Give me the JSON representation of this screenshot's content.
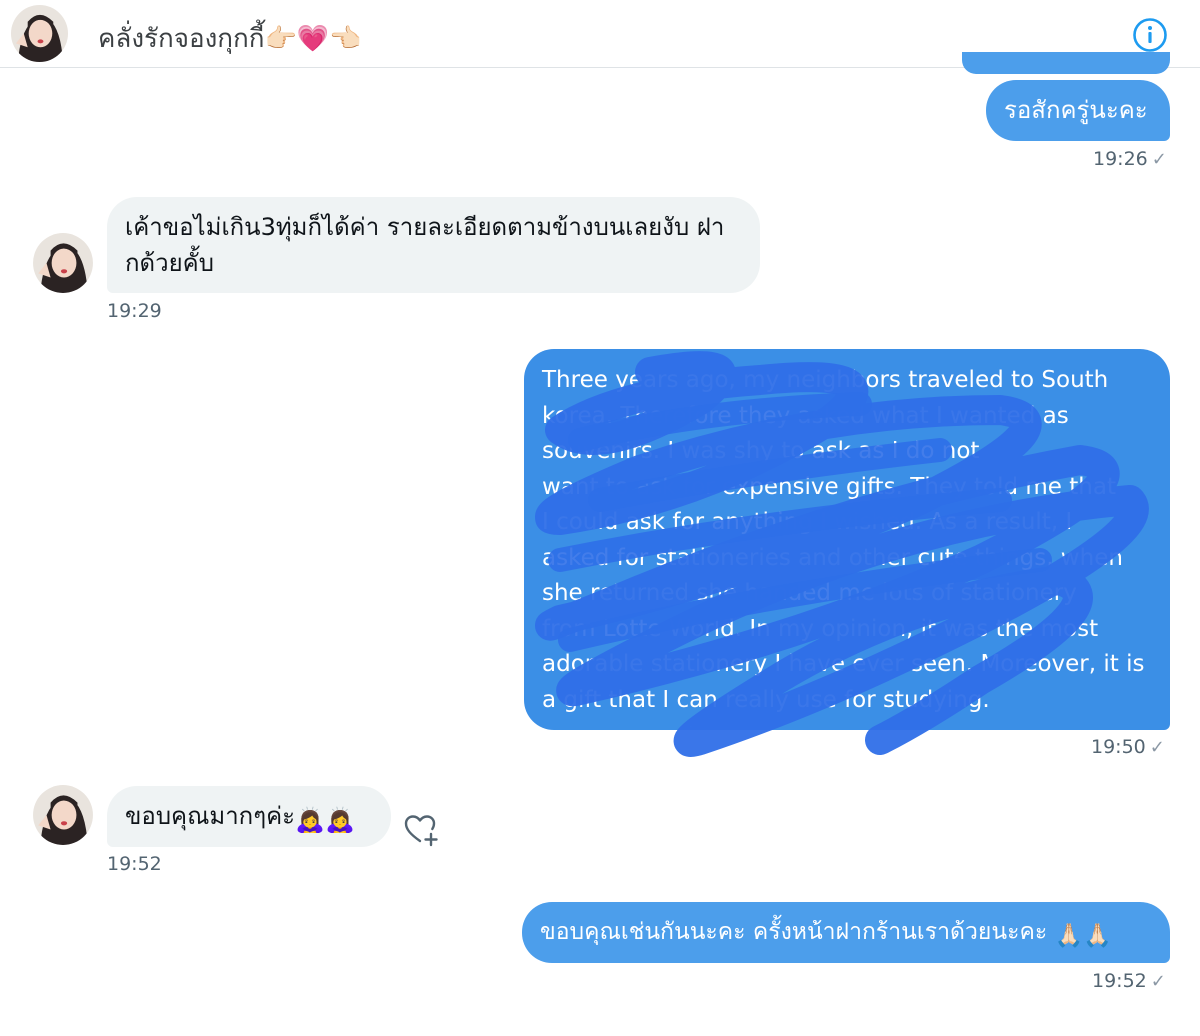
{
  "conversation": {
    "title": "คลั่งรักจองกุกกี้",
    "title_emoji": [
      "👉🏻",
      "💗",
      "👈🏻"
    ],
    "header_icons": [
      "avatar",
      "info-icon"
    ]
  },
  "messages": [
    {
      "id": "m1",
      "side": "out",
      "text": "รอสักครู่นะคะ",
      "time": "19:26",
      "status": "sent-check-icon"
    },
    {
      "id": "m2",
      "side": "in",
      "line1": "เค้าขอไม่เกิน3ทุ่มก็ได้ค่า รายละเอียดตามข้างบนเลยงับ ฝา",
      "line2": "กด้วยคั้บ",
      "time": "19:29"
    },
    {
      "id": "m3",
      "side": "out",
      "redacted": true,
      "lines": [
        "Three years ago, my neighbors traveled to South",
        "korea. Therefore they asked what I wanted as",
        "souvenirs. I was shy to ask as I do not",
        "want to ask for expensive gifts. They told me that",
        "I could ask for anything I wished. As a result, I",
        "asked for stationeries and other cute things, when",
        "she returned she handed me lots of stationery",
        "from Lotte World. In my opinion, it was the most",
        "adorable stationery I have ever seen. Moreover, it is",
        "a gift that I can really use for studying."
      ],
      "time": "19:50",
      "status": "sent-check-icon"
    },
    {
      "id": "m4",
      "side": "in",
      "text": "ขอบคุณมากๆค่ะ",
      "emoji": [
        "🙇‍♀️",
        "🙇‍♀️"
      ],
      "time": "19:52",
      "reaction_button": "add-reaction-heart-icon"
    },
    {
      "id": "m5",
      "side": "out",
      "text": "ขอบคุณเช่นกันนะคะ ครั้งหน้าฝากร้านเราด้วยนะคะ",
      "emoji": [
        "🙏🏻",
        "🙏🏻"
      ],
      "time": "19:52",
      "status": "sent-check-icon"
    }
  ],
  "colors": {
    "outgoing_bubble": "#4c9eeb",
    "incoming_bubble": "#eff3f4",
    "redaction_scribble": "#2f6fe8",
    "info_icon": "#1d9bf0",
    "timestamp": "#536471"
  }
}
